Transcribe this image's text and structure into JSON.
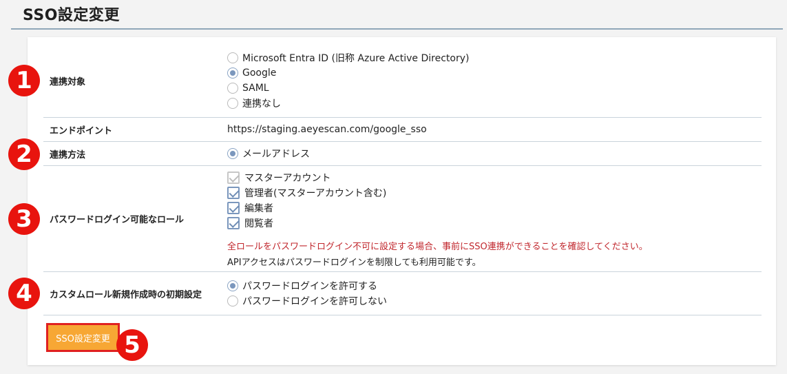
{
  "header": {
    "title": "SSO設定変更"
  },
  "form": {
    "rows": {
      "link_target": {
        "label": "連携対象",
        "options": [
          {
            "label": "Microsoft Entra ID (旧称 Azure Active Directory)",
            "selected": false
          },
          {
            "label": "Google",
            "selected": true
          },
          {
            "label": "SAML",
            "selected": false
          },
          {
            "label": "連携なし",
            "selected": false
          }
        ]
      },
      "endpoint": {
        "label": "エンドポイント",
        "value": "https://staging.aeyescan.com/google_sso"
      },
      "link_method": {
        "label": "連携方法",
        "options": [
          {
            "label": "メールアドレス",
            "selected": true
          }
        ]
      },
      "password_login_roles": {
        "label": "パスワードログイン可能なロール",
        "options": [
          {
            "label": "マスターアカウント",
            "checked": true,
            "disabled": true
          },
          {
            "label": "管理者(マスターアカウント含む)",
            "checked": true,
            "disabled": false
          },
          {
            "label": "編集者",
            "checked": true,
            "disabled": false
          },
          {
            "label": "閲覧者",
            "checked": true,
            "disabled": false
          }
        ],
        "warning": "全ロールをパスワードログイン不可に設定する場合、事前にSSO連携ができることを確認してください。",
        "note": "APIアクセスはパスワードログインを制限しても利用可能です。"
      },
      "custom_role_default": {
        "label": "カスタムロール新規作成時の初期設定",
        "options": [
          {
            "label": "パスワードログインを許可する",
            "selected": true
          },
          {
            "label": "パスワードログインを許可しない",
            "selected": false
          }
        ]
      }
    },
    "submit_label": "SSO設定変更"
  },
  "annotations": [
    "1",
    "2",
    "3",
    "4",
    "5"
  ],
  "colors": {
    "accent": "#7b97bd",
    "warning": "#c1272d",
    "button": "#f7a734",
    "badge": "#e8140e"
  }
}
